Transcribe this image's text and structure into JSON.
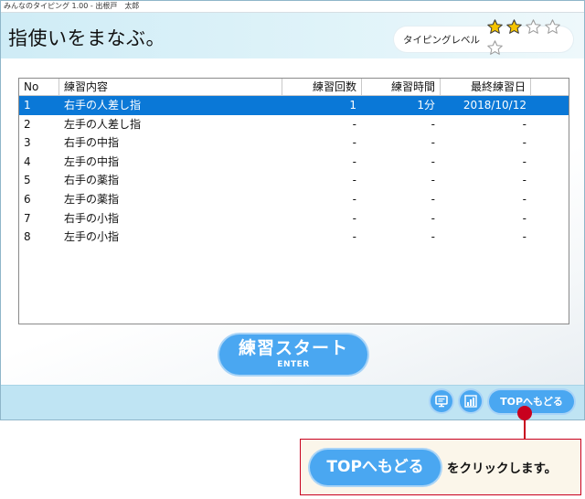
{
  "window": {
    "title": "みんなのタイピング 1.00 - 出根戸　太郎"
  },
  "header": {
    "page_title": "指使いをまなぶ。",
    "level_label": "タイピングレベル",
    "level_stars": 2,
    "level_max": 5
  },
  "table": {
    "columns": [
      "No",
      "練習内容",
      "練習回数",
      "練習時間",
      "最終練習日"
    ],
    "rows": [
      {
        "no": "1",
        "content": "右手の人差し指",
        "count": "1",
        "time": "1分",
        "last": "2018/10/12",
        "selected": true
      },
      {
        "no": "2",
        "content": "左手の人差し指",
        "count": "-",
        "time": "-",
        "last": "-"
      },
      {
        "no": "3",
        "content": "右手の中指",
        "count": "-",
        "time": "-",
        "last": "-"
      },
      {
        "no": "4",
        "content": "左手の中指",
        "count": "-",
        "time": "-",
        "last": "-"
      },
      {
        "no": "5",
        "content": "右手の薬指",
        "count": "-",
        "time": "-",
        "last": "-"
      },
      {
        "no": "6",
        "content": "左手の薬指",
        "count": "-",
        "time": "-",
        "last": "-"
      },
      {
        "no": "7",
        "content": "右手の小指",
        "count": "-",
        "time": "-",
        "last": "-"
      },
      {
        "no": "8",
        "content": "左手の小指",
        "count": "-",
        "time": "-",
        "last": "-"
      }
    ]
  },
  "start_button": {
    "label": "練習スタート",
    "key_hint": "ENTER"
  },
  "footer": {
    "icons": [
      "monitor-icon",
      "chart-icon"
    ],
    "top_button_label": "TOPへもどる"
  },
  "callout": {
    "button_label": "TOPへもどる",
    "text": "をクリックします。"
  },
  "colors": {
    "accent": "#4aa7f1",
    "selected_row": "#0a78d7",
    "star_fill": "#f5c400",
    "callout_border": "#c8001e"
  }
}
